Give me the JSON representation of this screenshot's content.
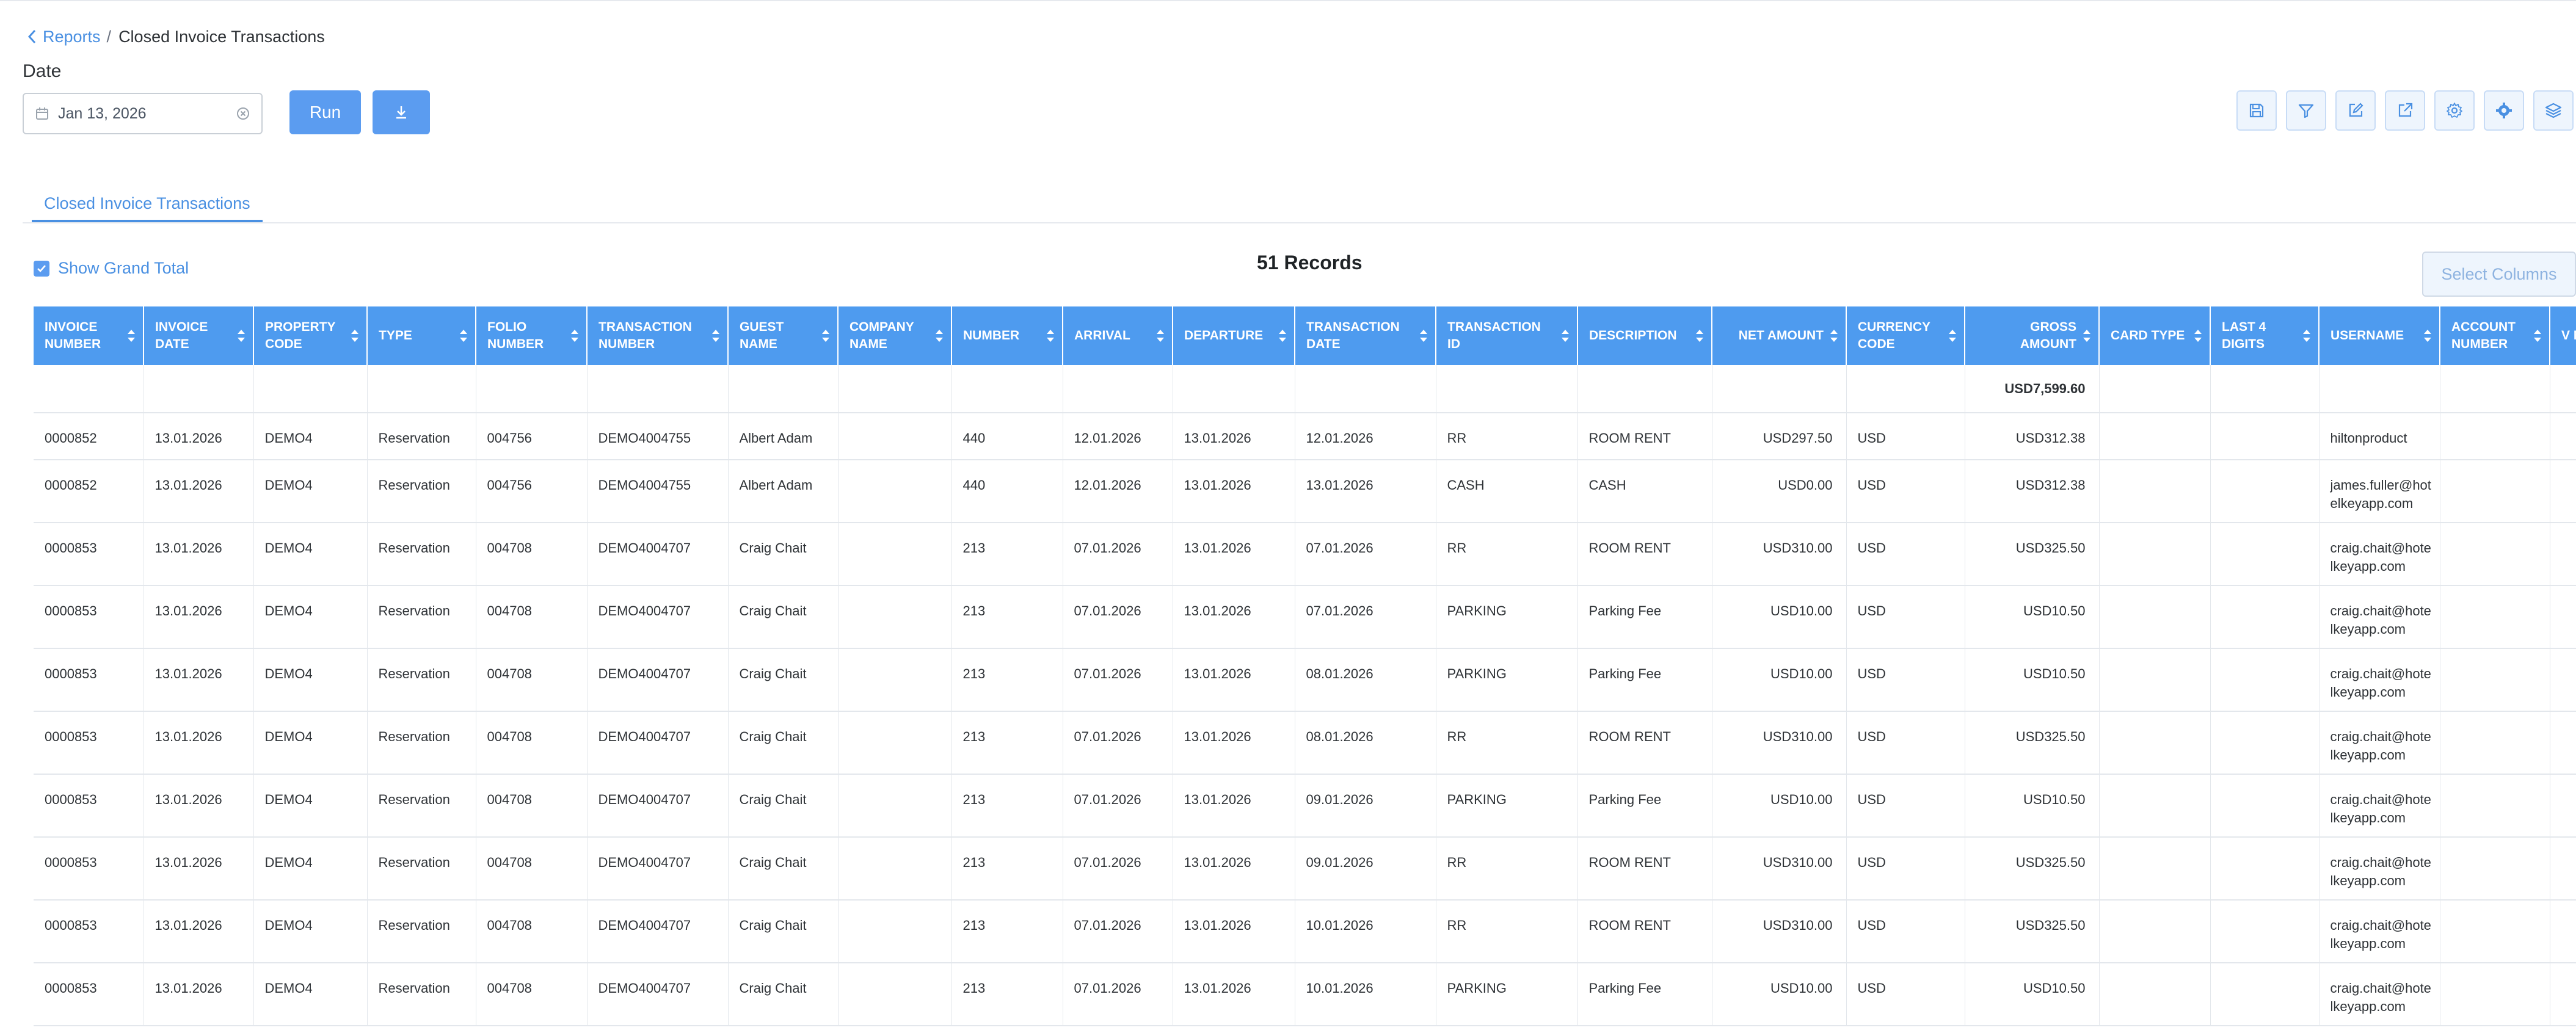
{
  "breadcrumb": {
    "parent": "Reports",
    "separator": "/",
    "current": "Closed Invoice Transactions"
  },
  "filters": {
    "date_label": "Date",
    "date_value": "Jan 13, 2026"
  },
  "buttons": {
    "run": "Run"
  },
  "toolbar_icons": [
    "save-icon",
    "filter-icon",
    "edit-icon",
    "export-icon",
    "settings-icon",
    "advanced-settings-icon",
    "layers-icon"
  ],
  "tabs": [
    {
      "label": "Closed Invoice Transactions"
    }
  ],
  "grand_total_label": "Show Grand Total",
  "records_label": "51 Records",
  "select_columns_label": "Select Columns",
  "colors": {
    "accent": "#4e9bef",
    "button": "#5b9cf0",
    "link": "#4a90e2"
  },
  "table": {
    "columns": [
      "INVOICE NUMBER",
      "INVOICE DATE",
      "PROPERTY CODE",
      "TYPE",
      "FOLIO NUMBER",
      "TRANSACTION NUMBER",
      "GUEST NAME",
      "COMPANY NAME",
      "NUMBER",
      "ARRIVAL",
      "DEPARTURE",
      "TRANSACTION DATE",
      "TRANSACTION ID",
      "DESCRIPTION",
      "NET AMOUNT",
      "CURRENCY CODE",
      "GROSS AMOUNT",
      "CARD TYPE",
      "LAST 4 DIGITS",
      "USERNAME",
      "ACCOUNT NUMBER",
      "V N"
    ],
    "total_row": {
      "gross_amount": "USD7,599.60"
    },
    "rows": [
      [
        "0000852",
        "13.01.2026",
        "DEMO4",
        "Reservation",
        "004756",
        "DEMO4004755",
        "Albert Adam",
        "",
        "440",
        "12.01.2026",
        "13.01.2026",
        "12.01.2026",
        "RR",
        "ROOM RENT",
        "USD297.50",
        "USD",
        "USD312.38",
        "",
        "",
        "hiltonproduct",
        "",
        ""
      ],
      [
        "0000852",
        "13.01.2026",
        "DEMO4",
        "Reservation",
        "004756",
        "DEMO4004755",
        "Albert Adam",
        "",
        "440",
        "12.01.2026",
        "13.01.2026",
        "13.01.2026",
        "CASH",
        "CASH",
        "USD0.00",
        "USD",
        "USD312.38",
        "",
        "",
        "james.fuller@hotelkeyapp.com",
        "",
        ""
      ],
      [
        "0000853",
        "13.01.2026",
        "DEMO4",
        "Reservation",
        "004708",
        "DEMO4004707",
        "Craig Chait",
        "",
        "213",
        "07.01.2026",
        "13.01.2026",
        "07.01.2026",
        "RR",
        "ROOM RENT",
        "USD310.00",
        "USD",
        "USD325.50",
        "",
        "",
        "craig.chait@hotelkeyapp.com",
        "",
        ""
      ],
      [
        "0000853",
        "13.01.2026",
        "DEMO4",
        "Reservation",
        "004708",
        "DEMO4004707",
        "Craig Chait",
        "",
        "213",
        "07.01.2026",
        "13.01.2026",
        "07.01.2026",
        "PARKING",
        "Parking Fee",
        "USD10.00",
        "USD",
        "USD10.50",
        "",
        "",
        "craig.chait@hotelkeyapp.com",
        "",
        ""
      ],
      [
        "0000853",
        "13.01.2026",
        "DEMO4",
        "Reservation",
        "004708",
        "DEMO4004707",
        "Craig Chait",
        "",
        "213",
        "07.01.2026",
        "13.01.2026",
        "08.01.2026",
        "PARKING",
        "Parking Fee",
        "USD10.00",
        "USD",
        "USD10.50",
        "",
        "",
        "craig.chait@hotelkeyapp.com",
        "",
        ""
      ],
      [
        "0000853",
        "13.01.2026",
        "DEMO4",
        "Reservation",
        "004708",
        "DEMO4004707",
        "Craig Chait",
        "",
        "213",
        "07.01.2026",
        "13.01.2026",
        "08.01.2026",
        "RR",
        "ROOM RENT",
        "USD310.00",
        "USD",
        "USD325.50",
        "",
        "",
        "craig.chait@hotelkeyapp.com",
        "",
        ""
      ],
      [
        "0000853",
        "13.01.2026",
        "DEMO4",
        "Reservation",
        "004708",
        "DEMO4004707",
        "Craig Chait",
        "",
        "213",
        "07.01.2026",
        "13.01.2026",
        "09.01.2026",
        "PARKING",
        "Parking Fee",
        "USD10.00",
        "USD",
        "USD10.50",
        "",
        "",
        "craig.chait@hotelkeyapp.com",
        "",
        ""
      ],
      [
        "0000853",
        "13.01.2026",
        "DEMO4",
        "Reservation",
        "004708",
        "DEMO4004707",
        "Craig Chait",
        "",
        "213",
        "07.01.2026",
        "13.01.2026",
        "09.01.2026",
        "RR",
        "ROOM RENT",
        "USD310.00",
        "USD",
        "USD325.50",
        "",
        "",
        "craig.chait@hotelkeyapp.com",
        "",
        ""
      ],
      [
        "0000853",
        "13.01.2026",
        "DEMO4",
        "Reservation",
        "004708",
        "DEMO4004707",
        "Craig Chait",
        "",
        "213",
        "07.01.2026",
        "13.01.2026",
        "10.01.2026",
        "RR",
        "ROOM RENT",
        "USD310.00",
        "USD",
        "USD325.50",
        "",
        "",
        "craig.chait@hotelkeyapp.com",
        "",
        ""
      ],
      [
        "0000853",
        "13.01.2026",
        "DEMO4",
        "Reservation",
        "004708",
        "DEMO4004707",
        "Craig Chait",
        "",
        "213",
        "07.01.2026",
        "13.01.2026",
        "10.01.2026",
        "PARKING",
        "Parking Fee",
        "USD10.00",
        "USD",
        "USD10.50",
        "",
        "",
        "craig.chait@hotelkeyapp.com",
        "",
        ""
      ]
    ]
  }
}
